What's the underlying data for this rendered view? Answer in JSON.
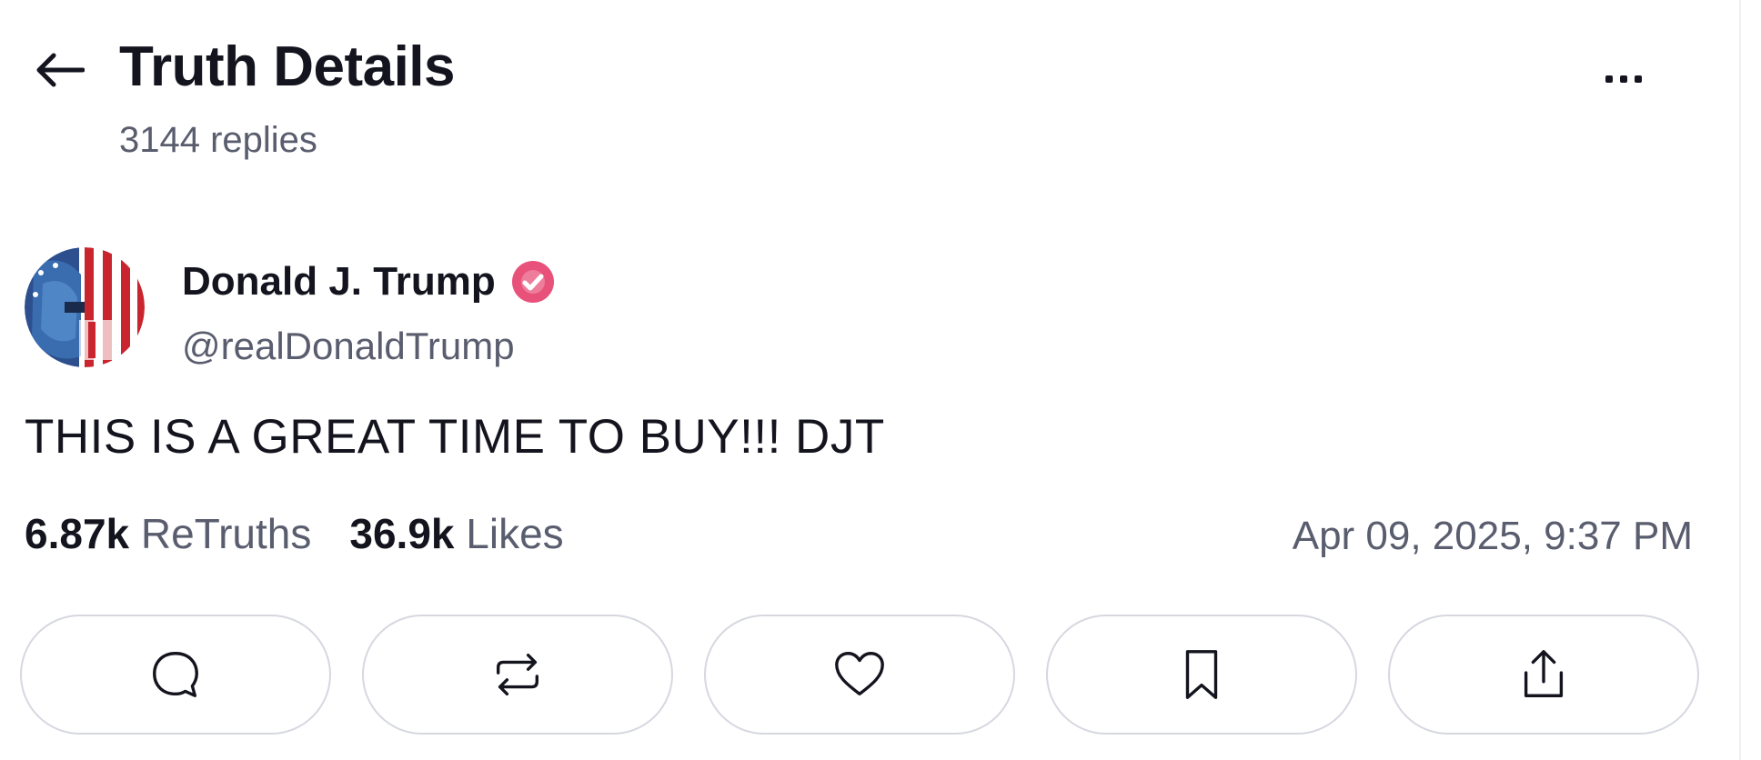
{
  "header": {
    "title": "Truth Details",
    "reply_count": "3144 replies",
    "back_icon": "arrow-left-icon",
    "more_icon": "more-options-icon"
  },
  "post": {
    "author": {
      "display_name": "Donald J. Trump",
      "handle": "@realDonaldTrump",
      "verified": true,
      "verified_color": "#e8527a"
    },
    "text": "THIS IS A GREAT TIME TO BUY!!! DJT",
    "stats": {
      "retruths_count": "6.87k",
      "retruths_label": "ReTruths",
      "likes_count": "36.9k",
      "likes_label": "Likes"
    },
    "timestamp": "Apr 09, 2025, 9:37 PM"
  },
  "actions": [
    {
      "name": "reply",
      "icon": "speech-bubble-icon"
    },
    {
      "name": "retruth",
      "icon": "repost-arrows-icon"
    },
    {
      "name": "like",
      "icon": "heart-icon"
    },
    {
      "name": "bookmark",
      "icon": "bookmark-icon"
    },
    {
      "name": "share",
      "icon": "share-upload-icon"
    }
  ],
  "colors": {
    "text_primary": "#14141f",
    "text_secondary": "#595d6e",
    "button_border": "#d6d8e0",
    "verified": "#e8527a"
  }
}
